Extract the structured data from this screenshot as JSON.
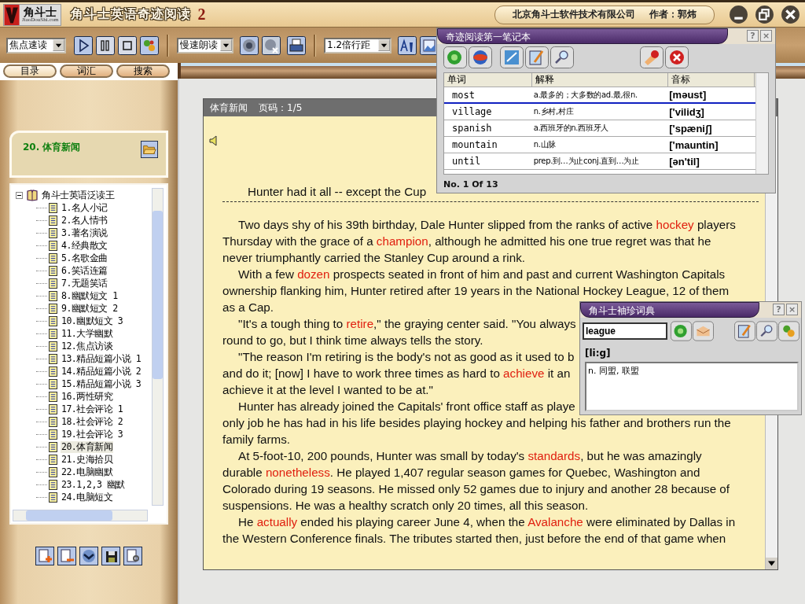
{
  "title_bar": {
    "logo": {
      "name": "角斗士",
      "site": "JiaoDouShi.com"
    },
    "title": "角斗士英语奇迹阅读",
    "edition": "2",
    "company": "北京角斗士软件技术有限公司",
    "author": "作者：郭炜"
  },
  "toolbar": {
    "reading_mode": "焦点速读",
    "speech_mode": "慢速朗读",
    "line_spacing": "1.2倍行距"
  },
  "tabs": [
    {
      "label": "目录",
      "selected": true
    },
    {
      "label": "词汇",
      "selected": false
    },
    {
      "label": "搜索",
      "selected": false
    }
  ],
  "sidebar": {
    "current": "20. 体育新闻",
    "tree": {
      "label": "角斗士英语泛读王",
      "expanded": true,
      "children": [
        {
          "label": "1.名人小记",
          "selected": false
        },
        {
          "label": "2.名人情书",
          "selected": false
        },
        {
          "label": "3.著名演说",
          "selected": false
        },
        {
          "label": "4.经典散文",
          "selected": false
        },
        {
          "label": "5.名歌金曲",
          "selected": false
        },
        {
          "label": "6.笑话连篇",
          "selected": false
        },
        {
          "label": "7.无题笑话",
          "selected": false
        },
        {
          "label": "8.幽默短文 1",
          "selected": false
        },
        {
          "label": "9.幽默短文 2",
          "selected": false
        },
        {
          "label": "10.幽默短文 3",
          "selected": false
        },
        {
          "label": "11.大学幽默",
          "selected": false
        },
        {
          "label": "12.焦点访谈",
          "selected": false
        },
        {
          "label": "13.精品短篇小说 1",
          "selected": false
        },
        {
          "label": "14.精品短篇小说 2",
          "selected": false
        },
        {
          "label": "15.精品短篇小说 3",
          "selected": false
        },
        {
          "label": "16.两性研究",
          "selected": false
        },
        {
          "label": "17.社会评论 1",
          "selected": false
        },
        {
          "label": "18.社会评论 2",
          "selected": false
        },
        {
          "label": "19.社会评论 3",
          "selected": false
        },
        {
          "label": "20.体育新闻",
          "selected": true
        },
        {
          "label": "21.史海拾贝",
          "selected": false
        },
        {
          "label": "22.电脑幽默",
          "selected": false
        },
        {
          "label": "23.1,2,3 幽默",
          "selected": false
        },
        {
          "label": "24.电脑短文",
          "selected": false
        }
      ]
    }
  },
  "document": {
    "category": "体育新闻",
    "page": "页码：1/5",
    "title": "Hunter had it all -- except the Cup",
    "lines": [
      {
        "indent": true,
        "parts": [
          {
            "text": "Two days shy of his 39th birthday, Dale Hunter slipped from the ranks of active ",
            "highlight": false
          },
          {
            "text": "hockey",
            "highlight": true
          },
          {
            "text": " players",
            "highlight": false
          }
        ]
      },
      {
        "indent": false,
        "parts": [
          {
            "text": "Thursday with the grace of a ",
            "highlight": false
          },
          {
            "text": "champion",
            "highlight": true
          },
          {
            "text": ", although he admitted his one true regret was that he",
            "highlight": false
          }
        ]
      },
      {
        "indent": false,
        "parts": [
          {
            "text": "never triumphantly carried the Stanley Cup around a rink.",
            "highlight": false
          }
        ]
      },
      {
        "indent": true,
        "parts": [
          {
            "text": "With a few ",
            "highlight": false
          },
          {
            "text": "dozen",
            "highlight": true
          },
          {
            "text": " prospects seated in front of him and past and current Washington Capitals",
            "highlight": false
          }
        ]
      },
      {
        "indent": false,
        "parts": [
          {
            "text": "ownership flanking him, Hunter retired after 19 years in the National Hockey League, 12 of them",
            "highlight": false
          }
        ]
      },
      {
        "indent": false,
        "parts": [
          {
            "text": "as a Cap.",
            "highlight": false
          }
        ]
      },
      {
        "indent": true,
        "parts": [
          {
            "text": "\"It's a tough thing to ",
            "highlight": false
          },
          {
            "text": "retire",
            "highlight": true
          },
          {
            "text": ",\" the graying center said. \"You always",
            "highlight": false
          }
        ]
      },
      {
        "indent": false,
        "parts": [
          {
            "text": "round to go, but I think time always tells the story.",
            "highlight": false
          }
        ]
      },
      {
        "indent": true,
        "parts": [
          {
            "text": "\"The reason I'm retiring is the body's not as good as it used to b",
            "highlight": false
          }
        ]
      },
      {
        "indent": false,
        "parts": [
          {
            "text": "and do it; [now] I have to work three times as hard to ",
            "highlight": false
          },
          {
            "text": "achieve",
            "highlight": true
          },
          {
            "text": " it an",
            "highlight": false
          }
        ]
      },
      {
        "indent": false,
        "parts": [
          {
            "text": "achieve it at the level I wanted to be at.\"",
            "highlight": false
          }
        ]
      },
      {
        "indent": true,
        "parts": [
          {
            "text": "Hunter has already joined the Capitals' front office staff as playe",
            "highlight": false
          }
        ]
      },
      {
        "indent": false,
        "parts": [
          {
            "text": "only job he has had in his life besides playing hockey and helping his father and brothers run the",
            "highlight": false
          }
        ]
      },
      {
        "indent": false,
        "parts": [
          {
            "text": "family farms.",
            "highlight": false
          }
        ]
      },
      {
        "indent": true,
        "parts": [
          {
            "text": "At 5-foot-10, 200 pounds, Hunter was small by today's ",
            "highlight": false
          },
          {
            "text": "standards",
            "highlight": true
          },
          {
            "text": ", but he was amazingly",
            "highlight": false
          }
        ]
      },
      {
        "indent": false,
        "parts": [
          {
            "text": "durable ",
            "highlight": false
          },
          {
            "text": "nonetheless",
            "highlight": true
          },
          {
            "text": ". He played 1,407 regular season games for Quebec, Washington and",
            "highlight": false
          }
        ]
      },
      {
        "indent": false,
        "parts": [
          {
            "text": "Colorado during 19 seasons. He missed only 52 games due to injury and another 28 because of",
            "highlight": false
          }
        ]
      },
      {
        "indent": false,
        "parts": [
          {
            "text": "suspensions. He was a healthy scratch only 20 times, all this season.",
            "highlight": false
          }
        ]
      },
      {
        "indent": true,
        "parts": [
          {
            "text": "He ",
            "highlight": false
          },
          {
            "text": "actually",
            "highlight": true
          },
          {
            "text": " ended his playing career June 4, when the ",
            "highlight": false
          },
          {
            "text": "Avalanche",
            "highlight": true
          },
          {
            "text": " were eliminated by Dallas in",
            "highlight": false
          }
        ]
      },
      {
        "indent": false,
        "parts": [
          {
            "text": "the Western Conference finals. The tributes started then, just before the end of that game when",
            "highlight": false
          }
        ]
      }
    ]
  },
  "notebook": {
    "title": "奇迹阅读第一笔记本",
    "help": "?",
    "close": "×",
    "columns": [
      "单词",
      "解释",
      "音标"
    ],
    "rows": [
      {
        "word": "most",
        "meaning": "a.最多的；大多数的ad.最,很n.",
        "phonetic": "[məust]",
        "selected": true
      },
      {
        "word": "village",
        "meaning": "n.乡村,村庄",
        "phonetic": "['vilidʒ]",
        "selected": false
      },
      {
        "word": "spanish",
        "meaning": "a.西班牙的n.西班牙人",
        "phonetic": "['spæniʃ]",
        "selected": false
      },
      {
        "word": "mountain",
        "meaning": "n.山脉",
        "phonetic": "['mauntin]",
        "selected": false
      },
      {
        "word": "until",
        "meaning": "prep.到…为止conj.直到…为止",
        "phonetic": "[ən'til]",
        "selected": false
      }
    ],
    "status": "No. 1 Of 13"
  },
  "dictionary": {
    "title": "角斗士袖珍词典",
    "help": "?",
    "close": "×",
    "query": "league",
    "phonetic": "[li:g]",
    "definition": "n. 同盟, 联盟"
  }
}
